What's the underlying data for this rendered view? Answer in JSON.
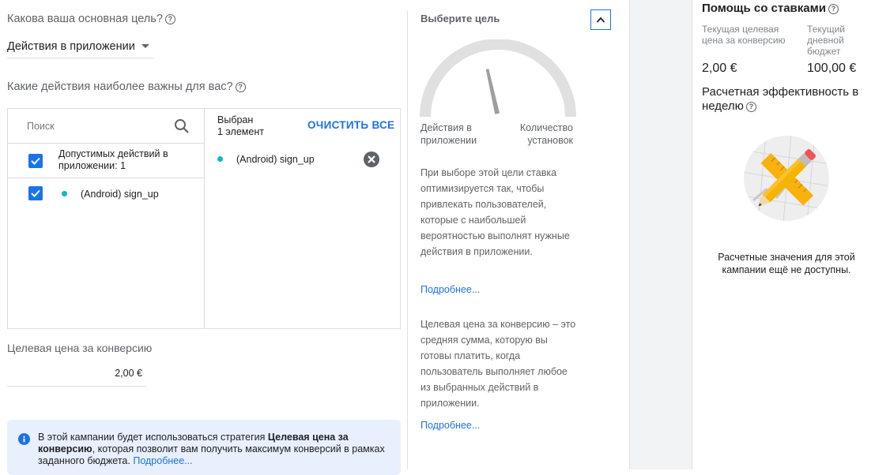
{
  "main": {
    "goal_question": "Какова ваша основная цель?",
    "goal_value": "Действия в приложении",
    "actions_question": "Какие действия наиболее важны для вас?",
    "search_placeholder": "Поиск",
    "group_label": "Допустимых действий в приложении: 1",
    "item_label": "(Android) sign_up",
    "selected_title": "Выбран",
    "selected_count": "1 элемент",
    "clear_all": "ОЧИСТИТЬ ВСЕ",
    "selected_item": "(Android) sign_up",
    "cpa_label": "Целевая цена за конверсию",
    "cpa_value": "2,00 €",
    "info_text_1": "В этой кампании будет использоваться стратегия ",
    "info_bold": "Целевая цена за конверсию",
    "info_text_2": ", которая позволит вам получить максимум конверсий в рамках заданного бюджета. ",
    "info_link": "Подробнее..."
  },
  "middle": {
    "title": "Выберите цель",
    "gauge_left": "Действия в приложении",
    "gauge_right": "Количество установок",
    "gauge_level": 0.43,
    "desc1": "При выборе этой цели ставка оптимизируется так, чтобы привлекать пользователей, которые с наибольшей вероятностью выполнят нужные действия в приложении.",
    "link1": "Подробнее...",
    "desc2": "Целевая цена за конверсию – это средняя сумма, которую вы готовы платить, когда пользователь выполняет любое из выбранных действий в приложении.",
    "link2": "Подробнее..."
  },
  "right": {
    "title": "Помощь со ставками",
    "col1_label": "Текущая целевая цена за конверсию",
    "col2_label": "Текущий дневной бюджет",
    "col1_value": "2,00 €",
    "col2_value": "100,00 €",
    "estimate_title": "Расчетная эффективность в неделю",
    "estimate_empty": "Расчетные значения для этой кампании ещё не доступны."
  },
  "colors": {
    "accent": "#1a73e8",
    "dot": "#12b5cb",
    "info_bg": "#e8f0fe"
  },
  "icons": [
    "help-icon",
    "dropdown-arrow-icon",
    "search-icon",
    "checkbox-checked-icon",
    "remove-circle-icon",
    "collapse-chevron-icon",
    "info-icon",
    "pencil-ruler-icon"
  ]
}
